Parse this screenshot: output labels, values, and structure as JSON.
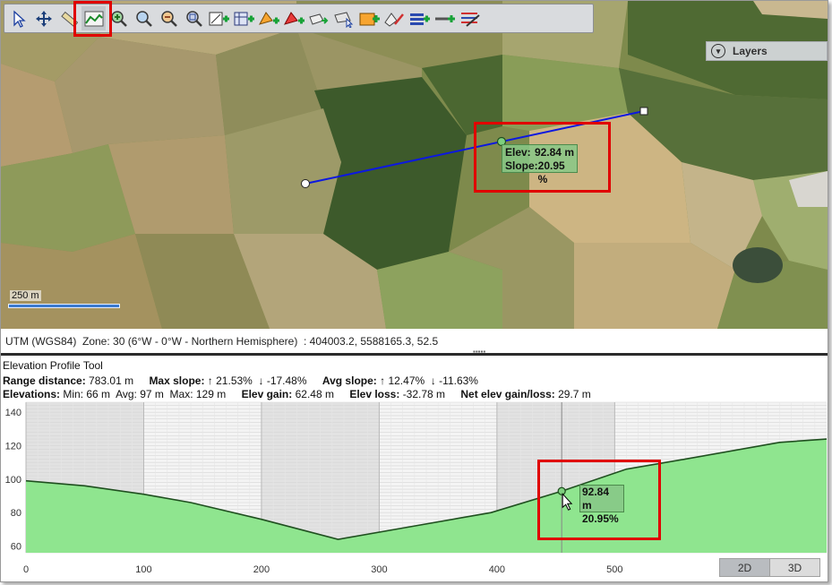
{
  "map": {
    "layers_label": "Layers",
    "scale_label": "250 m",
    "tooltip": {
      "elev_label": "Elev:",
      "elev_value": "92.84 m",
      "slope_label": "Slope:",
      "slope_value": "20.95 %"
    }
  },
  "toolbar": {
    "tools": [
      "select-arrow-icon",
      "pan-icon",
      "ruler-icon",
      "elevation-profile-icon",
      "zoom-in-icon",
      "zoom-icon",
      "zoom-out-icon",
      "zoom-extent-icon",
      "add-grid-icon",
      "add-table-icon",
      "add-polygon-icon",
      "add-polygon-red-icon",
      "move-area-icon",
      "select-area-icon",
      "add-rectangle-icon",
      "edit-pen-icon",
      "add-list-icon",
      "add-line-icon",
      "layer-style-icon"
    ],
    "active_tool": "elevation-profile-icon"
  },
  "status": {
    "text": "UTM (WGS84)  Zone: 30 (6°W - 0°W - Northern Hemisphere)  : 404003.2, 5588165.3, 52.5"
  },
  "profile": {
    "title": "Elevation Profile Tool",
    "range_label": "Range distance:",
    "range_value": "783.01 m",
    "max_slope_label": "Max slope:",
    "max_slope_value": "↑ 21.53%  ↓ -17.48%",
    "avg_slope_label": "Avg slope:",
    "avg_slope_value": "↑ 12.47%  ↓ -11.63%",
    "elevations_label": "Elevations:",
    "elevations_value": "Min: 66 m  Avg: 97 m  Max: 129 m",
    "elev_gain_label": "Elev gain:",
    "elev_gain_value": "62.48 m",
    "elev_loss_label": "Elev loss:",
    "elev_loss_value": "-32.78 m",
    "net_label": "Net elev gain/loss:",
    "net_value": "29.7 m",
    "tooltip_elev": "92.84 m",
    "tooltip_slope": "20.95%",
    "toggle_2d": "2D",
    "toggle_3d": "3D"
  },
  "chart_data": {
    "type": "area",
    "x": [
      0,
      50,
      100,
      140,
      200,
      265,
      330,
      395,
      455,
      510,
      560,
      640,
      680
    ],
    "y": [
      99,
      96,
      91,
      86,
      76,
      64,
      72,
      80,
      92.84,
      106,
      112,
      122,
      124
    ],
    "cursor_x": 455,
    "xlim": [
      0,
      680
    ],
    "ylim": [
      56,
      146
    ],
    "xticks": [
      0,
      100,
      200,
      300,
      400,
      500
    ],
    "yticks": [
      60,
      80,
      100,
      120,
      140
    ],
    "grid": true,
    "fill_color": "#8fe58f",
    "line_color": "#1f4f1f"
  }
}
